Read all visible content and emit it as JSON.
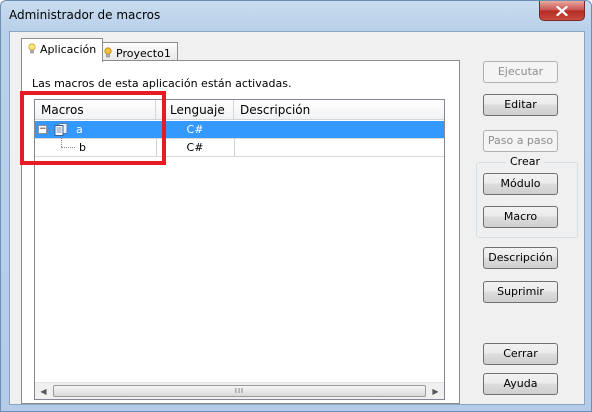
{
  "window": {
    "title": "Administrador de macros"
  },
  "tabs": [
    {
      "label": "Aplicación",
      "active": true
    },
    {
      "label": "Proyecto1",
      "active": false
    }
  ],
  "info_text": "Las macros de esta aplicación están activadas.",
  "grid": {
    "columns": [
      "Macros",
      "Lenguaje",
      "Descripción"
    ],
    "rows": [
      {
        "name": "a",
        "language": "C#",
        "description": "",
        "selected": true,
        "level": 0,
        "expanded": true
      },
      {
        "name": "b",
        "language": "C#",
        "description": "",
        "selected": false,
        "level": 1
      }
    ],
    "scroll_grip": "III"
  },
  "buttons": {
    "ejecutar": "Ejecutar",
    "editar": "Editar",
    "paso_a_paso": "Paso a paso",
    "crear_group": "Crear",
    "modulo": "Módulo",
    "macro": "Macro",
    "descripcion": "Descripción",
    "suprimir": "Suprimir",
    "cerrar": "Cerrar",
    "ayuda": "Ayuda"
  },
  "colors": {
    "selection": "#3399ff",
    "highlight_box": "#e51c23",
    "close_button": "#c94b3f"
  },
  "icons": {
    "tab_icon": "lightbulb-icon",
    "tree_node_icon": "module-icon",
    "close": "close-icon"
  }
}
